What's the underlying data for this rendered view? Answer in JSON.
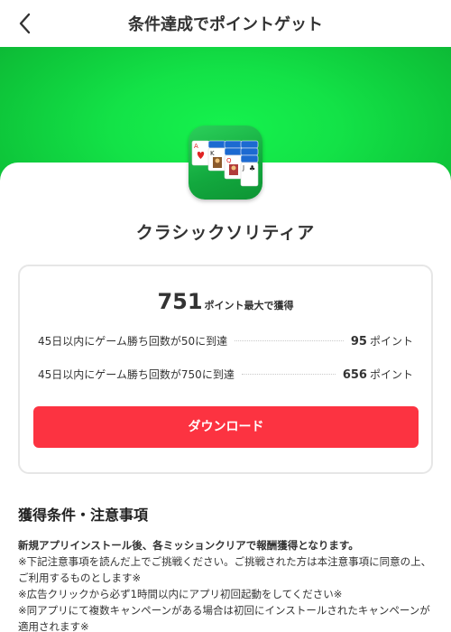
{
  "header": {
    "title": "条件達成でポイントゲット",
    "back_icon": "chevron-left-icon"
  },
  "colors": {
    "hero_green": "#13e247",
    "button_red": "#fc3341"
  },
  "app": {
    "name": "クラシックソリティア",
    "icon": "solitaire-app-icon"
  },
  "card": {
    "total_points": "751",
    "total_suffix": "ポイント最大で獲得",
    "conditions": [
      {
        "text": "45日以内にゲーム勝ち回数が50に到達",
        "points": "95",
        "unit": "ポイント"
      },
      {
        "text": "45日以内にゲーム勝ち回数が750に到達",
        "points": "656",
        "unit": "ポイント"
      }
    ],
    "download_label": "ダウンロード"
  },
  "notes": {
    "title": "獲得条件・注意事項",
    "lead": "新規アプリインストール後、各ミッションクリアで報酬獲得となります。",
    "lines": [
      "※下記注意事項を読んだ上でご挑戦ください。ご挑戦された方は本注意事項に同意の上、ご利用するものとします※",
      "※広告クリックから必ず1時間以内にアプリ初回起動をしてください※",
      "※同アプリにて複数キャンペーンがある場合は初回にインストールされたキャンペーンが適用されます※"
    ]
  }
}
